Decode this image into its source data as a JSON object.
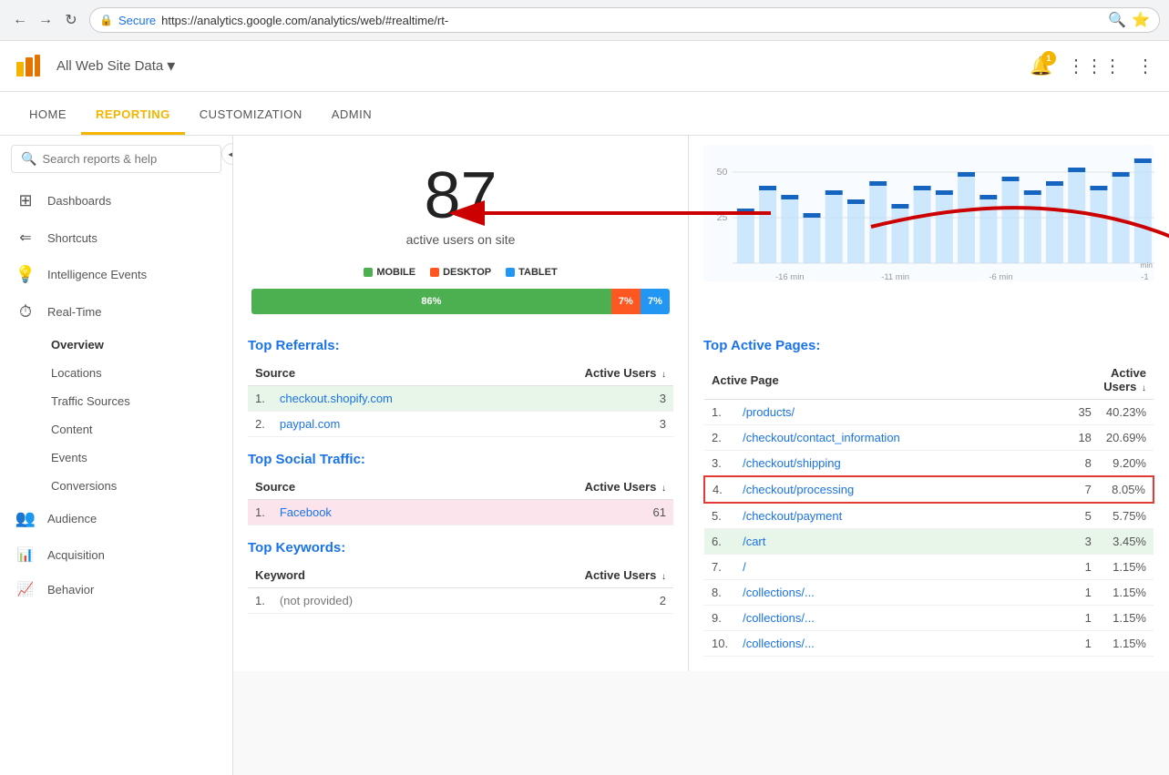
{
  "browser": {
    "url": "https://analytics.google.com/analytics/web/#realtime/rt-",
    "secure_label": "Secure"
  },
  "topbar": {
    "account_name": "All Web Site Data",
    "notification_count": "1"
  },
  "nav_tabs": [
    {
      "id": "home",
      "label": "HOME",
      "active": false
    },
    {
      "id": "reporting",
      "label": "REPORTING",
      "active": true
    },
    {
      "id": "customization",
      "label": "CUSTOMIZATION",
      "active": false
    },
    {
      "id": "admin",
      "label": "ADMIN",
      "active": false
    }
  ],
  "sidebar": {
    "search_placeholder": "Search reports & help",
    "items": [
      {
        "id": "dashboards",
        "label": "Dashboards",
        "icon": "⊞"
      },
      {
        "id": "shortcuts",
        "label": "Shortcuts",
        "icon": "←"
      },
      {
        "id": "intelligence-events",
        "label": "Intelligence Events",
        "icon": "💡"
      },
      {
        "id": "realtime",
        "label": "Real-Time",
        "icon": "⏱"
      }
    ],
    "realtime_subitems": [
      {
        "id": "overview",
        "label": "Overview",
        "active": true
      },
      {
        "id": "locations",
        "label": "Locations",
        "active": false
      },
      {
        "id": "traffic-sources",
        "label": "Traffic Sources",
        "active": false
      },
      {
        "id": "content",
        "label": "Content",
        "active": false
      },
      {
        "id": "events",
        "label": "Events",
        "active": false
      },
      {
        "id": "conversions",
        "label": "Conversions",
        "active": false
      }
    ],
    "bottom_items": [
      {
        "id": "audience",
        "label": "Audience",
        "icon": "👥"
      },
      {
        "id": "acquisition",
        "label": "Acquisition",
        "icon": "📊"
      },
      {
        "id": "behavior",
        "label": "Behavior",
        "icon": "📈"
      }
    ]
  },
  "main": {
    "active_count": "87",
    "active_label": "active users on site",
    "legend": {
      "mobile": {
        "label": "MOBILE",
        "color": "#4caf50"
      },
      "desktop": {
        "label": "DESKTOP",
        "color": "#ff5722"
      },
      "tablet": {
        "label": "TABLET",
        "color": "#2196f3"
      }
    },
    "progress_bar": {
      "mobile_pct": 86,
      "mobile_label": "86%",
      "desktop_pct": 7,
      "desktop_label": "7%",
      "tablet_pct": 7,
      "tablet_label": "7%"
    },
    "chart": {
      "y_labels": [
        "50",
        "25"
      ],
      "x_labels": [
        "-16 min",
        "-11 min",
        "-6 min",
        "-1"
      ]
    },
    "top_referrals": {
      "title": "Top Referrals:",
      "col_source": "Source",
      "col_users": "Active Users",
      "rows": [
        {
          "num": "1.",
          "source": "checkout.shopify.com",
          "users": "3",
          "highlight": "green"
        },
        {
          "num": "2.",
          "source": "paypal.com",
          "users": "3",
          "highlight": ""
        }
      ]
    },
    "top_social": {
      "title": "Top Social Traffic:",
      "col_source": "Source",
      "col_users": "Active Users",
      "rows": [
        {
          "num": "1.",
          "source": "Facebook",
          "users": "61",
          "highlight": "pink"
        }
      ]
    },
    "top_keywords": {
      "title": "Top Keywords:",
      "col_keyword": "Keyword",
      "col_users": "Active Users",
      "rows": [
        {
          "num": "1.",
          "keyword": "(not provided)",
          "users": "2",
          "highlight": ""
        }
      ]
    },
    "top_active_pages": {
      "title": "Top Active Pages:",
      "col_page": "Active Page",
      "col_users": "Active Users",
      "rows": [
        {
          "num": "1.",
          "page": "/products/",
          "users": "35",
          "pct": "40.23%",
          "highlight": ""
        },
        {
          "num": "2.",
          "page": "/checkout/contact_information",
          "users": "18",
          "pct": "20.69%",
          "highlight": ""
        },
        {
          "num": "3.",
          "page": "/checkout/shipping",
          "users": "8",
          "pct": "9.20%",
          "highlight": ""
        },
        {
          "num": "4.",
          "page": "/checkout/processing",
          "users": "7",
          "pct": "8.05%",
          "highlight": "red-border"
        },
        {
          "num": "5.",
          "page": "/checkout/payment",
          "users": "5",
          "pct": "5.75%",
          "highlight": ""
        },
        {
          "num": "6.",
          "page": "/cart",
          "users": "3",
          "pct": "3.45%",
          "highlight": "green"
        },
        {
          "num": "7.",
          "page": "/",
          "users": "1",
          "pct": "1.15%",
          "highlight": ""
        },
        {
          "num": "8.",
          "page": "/collections/...",
          "users": "1",
          "pct": "1.15%",
          "highlight": ""
        },
        {
          "num": "9.",
          "page": "/collections/...",
          "users": "1",
          "pct": "1.15%",
          "highlight": ""
        },
        {
          "num": "10.",
          "page": "/collections/...",
          "users": "1",
          "pct": "1.15%",
          "highlight": ""
        }
      ]
    }
  }
}
